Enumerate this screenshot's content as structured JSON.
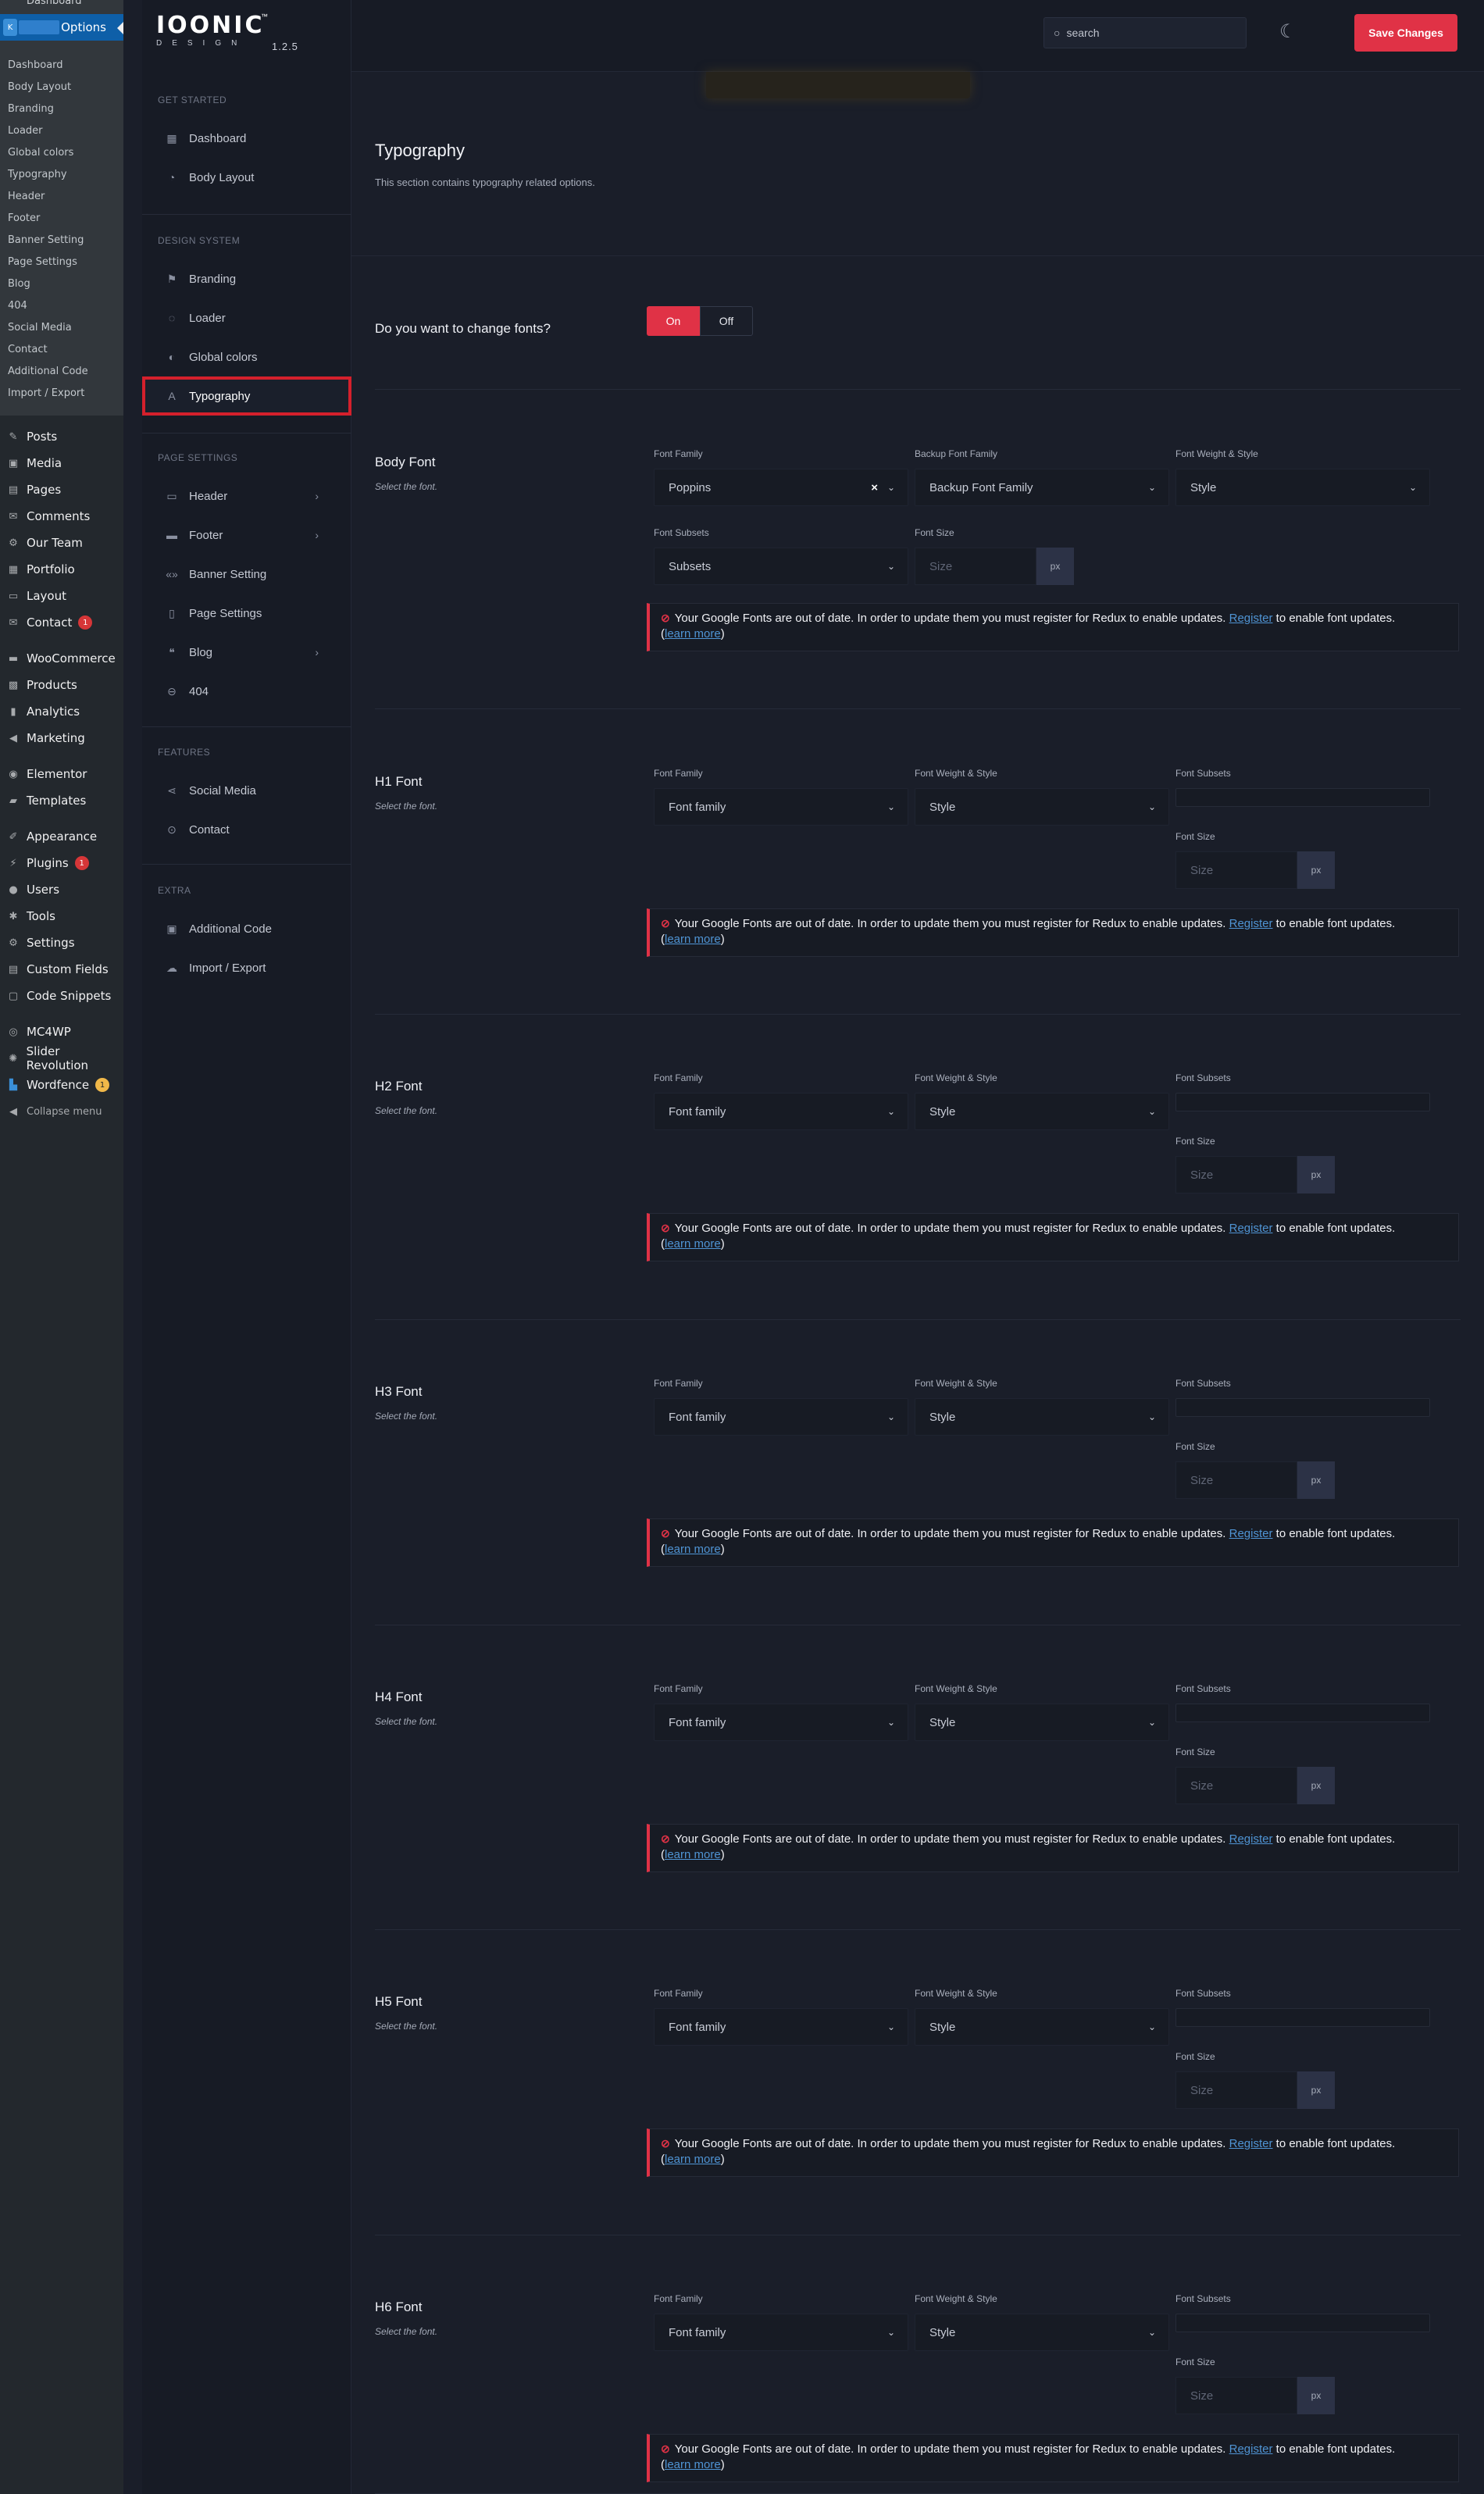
{
  "wp_sidebar": {
    "cut_item": "Dashboard",
    "options_label": "Options",
    "submenu": [
      "Dashboard",
      "Body Layout",
      "Branding",
      "Loader",
      "Global colors",
      "Typography",
      "Header",
      "Footer",
      "Banner Setting",
      "Page Settings",
      "Blog",
      "404",
      "Social Media",
      "Contact",
      "Additional Code",
      "Import / Export"
    ],
    "menu": {
      "posts": "Posts",
      "media": "Media",
      "pages": "Pages",
      "comments": "Comments",
      "our_team": "Our Team",
      "portfolio": "Portfolio",
      "layout": "Layout",
      "contact": "Contact",
      "contact_badge": "1",
      "woocommerce": "WooCommerce",
      "products": "Products",
      "analytics": "Analytics",
      "marketing": "Marketing",
      "elementor": "Elementor",
      "templates": "Templates",
      "appearance": "Appearance",
      "plugins": "Plugins",
      "plugins_badge": "1",
      "users": "Users",
      "tools": "Tools",
      "settings": "Settings",
      "custom_fields": "Custom Fields",
      "code_snippets": "Code Snippets",
      "mc4wp": "MC4WP",
      "slider_revolution": "Slider Revolution",
      "wordfence": "Wordfence",
      "wordfence_badge": "1",
      "collapse": "Collapse menu"
    }
  },
  "logo": {
    "text": "IOONIC",
    "tm": "™",
    "sub": "DESIGN",
    "version": "1.2.5"
  },
  "nav": {
    "get_started": {
      "heading": "GET STARTED",
      "items": [
        "Dashboard",
        "Body Layout"
      ]
    },
    "design_system": {
      "heading": "DESIGN SYSTEM",
      "items": [
        "Branding",
        "Loader",
        "Global colors",
        "Typography"
      ]
    },
    "page_settings": {
      "heading": "PAGE SETTINGS",
      "items": [
        "Header",
        "Footer",
        "Banner Setting",
        "Page Settings",
        "Blog",
        "404"
      ]
    },
    "features": {
      "heading": "FEATURES",
      "items": [
        "Social Media",
        "Contact"
      ]
    },
    "extra": {
      "heading": "EXTRA",
      "items": [
        "Additional Code",
        "Import / Export"
      ]
    },
    "active": "Typography"
  },
  "topbar": {
    "search_placeholder": "search",
    "save_label": "Save Changes"
  },
  "section": {
    "title": "Typography",
    "description": "This section contains typography related options."
  },
  "change_fonts": {
    "label": "Do you want to change fonts?",
    "on": "On",
    "off": "Off",
    "value": "On"
  },
  "body_font": {
    "title": "Body Font",
    "subtitle": "Select the font.",
    "font_family_label": "Font Family",
    "font_family_value": "Poppins",
    "backup_label": "Backup Font Family",
    "backup_placeholder": "Backup Font Family",
    "weight_label": "Font Weight & Style",
    "weight_placeholder": "Style",
    "subsets_label": "Font Subsets",
    "subsets_placeholder": "Subsets",
    "size_label": "Font Size",
    "size_placeholder": "Size",
    "unit": "px"
  },
  "headings": [
    {
      "title": "H1 Font"
    },
    {
      "title": "H2 Font"
    },
    {
      "title": "H3 Font"
    },
    {
      "title": "H4 Font"
    },
    {
      "title": "H5 Font"
    },
    {
      "title": "H6 Font"
    }
  ],
  "heading_fields": {
    "subtitle": "Select the font.",
    "font_family_label": "Font Family",
    "font_family_placeholder": "Font family",
    "weight_label": "Font Weight & Style",
    "weight_placeholder": "Style",
    "subsets_label": "Font Subsets",
    "size_label": "Font Size",
    "size_placeholder": "Size",
    "unit": "px"
  },
  "notice": {
    "text": "Your Google Fonts are out of date. In order to update them you must register for Redux to enable updates.",
    "register": "Register",
    "after": "to enable font updates.",
    "learn_open": "(",
    "learn": "learn more",
    "learn_close": ")"
  },
  "colors": {
    "accent": "#e03246",
    "bg": "#1a1e29",
    "panel": "#171b25",
    "link": "#4f94d4"
  }
}
